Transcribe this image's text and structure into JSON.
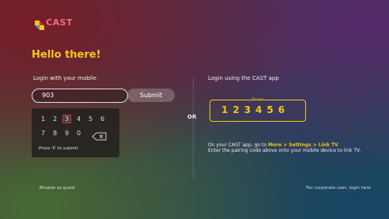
{
  "brand": {
    "logo_text": "CAST",
    "colors": [
      "#f5c518",
      "#d0342c",
      "#4a90d9"
    ]
  },
  "greeting": "Hello there!",
  "mobile_login": {
    "label": "Login with your mobile",
    "input_value": "903",
    "submit_label": "Submit",
    "keypad": {
      "row1": [
        "1",
        "2",
        "3",
        "4",
        "5",
        "6"
      ],
      "row2": [
        "7",
        "8",
        "9",
        "0"
      ],
      "backspace_icon": "backspace-icon",
      "focused_key": "3",
      "hint": "Press ⦿ to submit"
    }
  },
  "separator": "OR",
  "app_login": {
    "label": "Login using the CAST app",
    "code_caption": "20 secs",
    "pairing_code": "123456",
    "instruction_prefix": "On your CAST app, go to ",
    "instruction_path": "More > Settings > Link TV",
    "instruction_line2": "Enter the pairing code above onto your mobile device to link TV."
  },
  "footer": {
    "guest_label": "Browse as guest",
    "corporate_label": "For corporate user, login here"
  },
  "accent_color": "#f5c518"
}
